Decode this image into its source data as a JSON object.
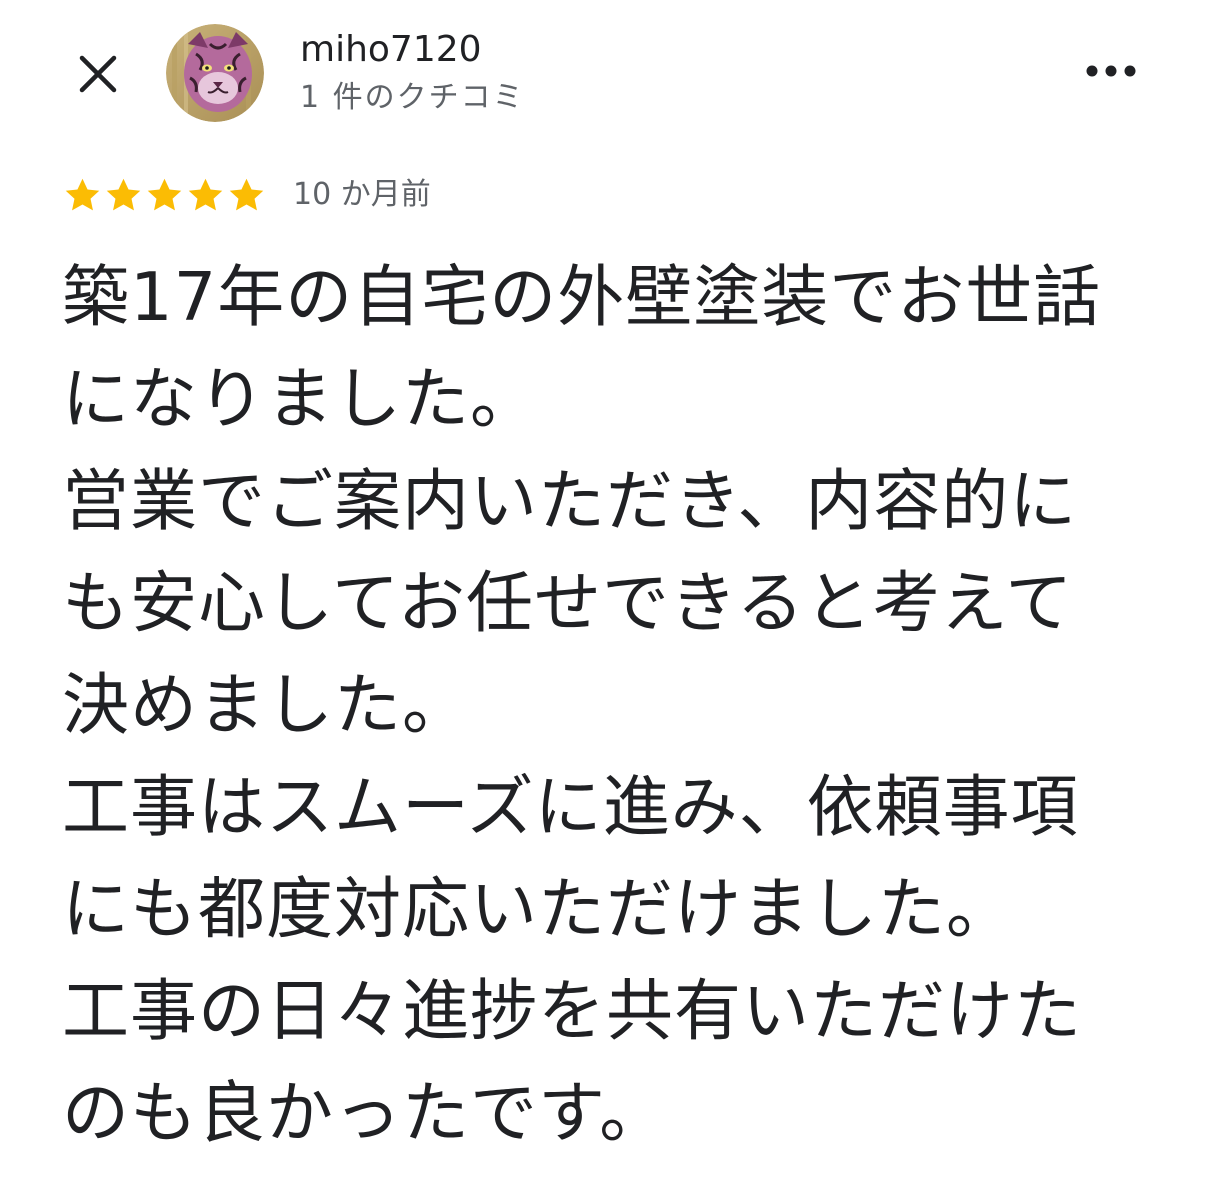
{
  "header": {
    "close_icon": "close-icon",
    "user_name": "miho7120",
    "review_count": "1 件のクチコミ",
    "more_icon": "more-horizontal-icon"
  },
  "review": {
    "rating": 5,
    "rating_max": 5,
    "star_color": "#fbbc04",
    "time_ago": "10 か月前",
    "lines": [
      "築17年の自宅の外壁塗装でお世話",
      "になりました。",
      "営業でご案内いただき、内容的に",
      "も安心してお任せできると考えて",
      "決めました。",
      "工事はスムーズに進み、依頼事項",
      "にも都度対応いただけました。",
      "工事の日々進捗を共有いただけた",
      "のも良かったです。"
    ]
  }
}
